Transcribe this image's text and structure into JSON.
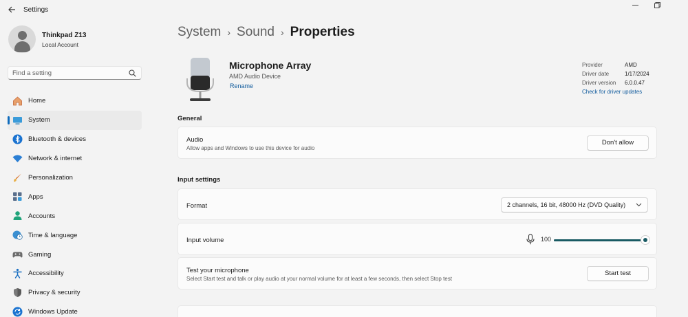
{
  "window": {
    "title": "Settings",
    "back_icon": "arrow-left-icon",
    "minimize_icon": "minimize-icon",
    "restore_icon": "restore-icon"
  },
  "user": {
    "name": "Thinkpad Z13",
    "account": "Local Account"
  },
  "search": {
    "placeholder": "Find a setting"
  },
  "sidebar": {
    "items": [
      {
        "label": "Home",
        "icon": "home-icon",
        "active": false
      },
      {
        "label": "System",
        "icon": "monitor-icon",
        "active": true
      },
      {
        "label": "Bluetooth & devices",
        "icon": "bluetooth-icon",
        "active": false
      },
      {
        "label": "Network & internet",
        "icon": "wifi-icon",
        "active": false
      },
      {
        "label": "Personalization",
        "icon": "brush-icon",
        "active": false
      },
      {
        "label": "Apps",
        "icon": "apps-icon",
        "active": false
      },
      {
        "label": "Accounts",
        "icon": "person-icon",
        "active": false
      },
      {
        "label": "Time & language",
        "icon": "globe-clock-icon",
        "active": false
      },
      {
        "label": "Gaming",
        "icon": "gamepad-icon",
        "active": false
      },
      {
        "label": "Accessibility",
        "icon": "accessibility-icon",
        "active": false
      },
      {
        "label": "Privacy & security",
        "icon": "shield-icon",
        "active": false
      },
      {
        "label": "Windows Update",
        "icon": "update-icon",
        "active": false
      }
    ]
  },
  "breadcrumb": {
    "level1": "System",
    "level2": "Sound",
    "current": "Properties",
    "separator": "›"
  },
  "device": {
    "name": "Microphone Array",
    "subtitle": "AMD Audio Device",
    "rename": "Rename",
    "icon": "microphone-illustration"
  },
  "driver": {
    "provider_label": "Provider",
    "provider": "AMD",
    "date_label": "Driver date",
    "date": "1/17/2024",
    "version_label": "Driver version",
    "version": "6.0.0.47",
    "update_link": "Check for driver updates"
  },
  "general": {
    "title": "General",
    "audio": {
      "title": "Audio",
      "description": "Allow apps and Windows to use this device for audio",
      "button": "Don't allow"
    }
  },
  "input_settings": {
    "title": "Input settings",
    "format": {
      "label": "Format",
      "value": "2 channels, 16 bit, 48000 Hz (DVD Quality)"
    },
    "volume": {
      "label": "Input volume",
      "value": "100",
      "level": 1.0
    },
    "test": {
      "title": "Test your microphone",
      "description": "Select Start test and talk or play audio at your normal volume for at least a few seconds, then select Stop test",
      "button": "Start test"
    }
  },
  "colors": {
    "accent": "#0f6cbd",
    "slider": "#195a63",
    "link": "#0f5a9c",
    "background": "#f3f3f3",
    "card": "#fbfbfb"
  }
}
